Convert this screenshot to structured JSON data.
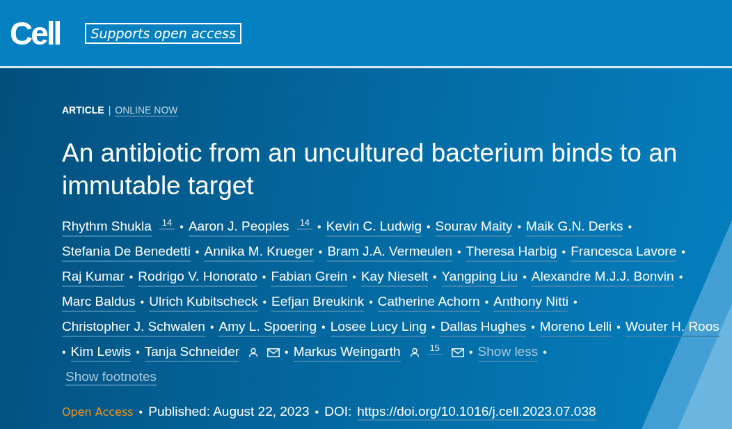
{
  "header": {
    "logo": "Cell",
    "badge": "Supports open access"
  },
  "article_type": "ARTICLE",
  "separator": "|",
  "status": "ONLINE NOW",
  "title": "An antibiotic from an uncultured bacterium binds to an immutable target",
  "author_separator": "•",
  "authors": [
    {
      "name": "Rhythm Shukla",
      "marks": [
        {
          "kind": "footnote",
          "text": "14"
        }
      ]
    },
    {
      "name": "Aaron J. Peoples",
      "marks": [
        {
          "kind": "footnote",
          "text": "14"
        }
      ]
    },
    {
      "name": "Kevin C. Ludwig"
    },
    {
      "name": "Sourav Maity"
    },
    {
      "name": "Maik G.N. Derks"
    },
    {
      "name": "Stefania De Benedetti"
    },
    {
      "name": "Annika M. Krueger"
    },
    {
      "name": "Bram J.A. Vermeulen"
    },
    {
      "name": "Theresa Harbig"
    },
    {
      "name": "Francesca Lavore"
    },
    {
      "name": "Raj Kumar"
    },
    {
      "name": "Rodrigo V. Honorato"
    },
    {
      "name": "Fabian Grein"
    },
    {
      "name": "Kay Nieselt"
    },
    {
      "name": "Yangping Liu"
    },
    {
      "name": "Alexandre M.J.J. Bonvin"
    },
    {
      "name": "Marc Baldus"
    },
    {
      "name": "Ulrich Kubitscheck"
    },
    {
      "name": "Eefjan Breukink"
    },
    {
      "name": "Catherine Achorn"
    },
    {
      "name": "Anthony Nitti"
    },
    {
      "name": "Christopher J. Schwalen"
    },
    {
      "name": "Amy L. Spoering"
    },
    {
      "name": "Losee Lucy Ling"
    },
    {
      "name": "Dallas Hughes"
    },
    {
      "name": "Moreno Lelli"
    },
    {
      "name": "Wouter H. Roos"
    },
    {
      "name": "Kim Lewis"
    },
    {
      "name": "Tanja Schneider",
      "marks": [
        {
          "kind": "person"
        },
        {
          "kind": "mail"
        }
      ]
    },
    {
      "name": "Markus Weingarth",
      "marks": [
        {
          "kind": "person"
        },
        {
          "kind": "footnote",
          "text": "15"
        },
        {
          "kind": "mail"
        }
      ]
    }
  ],
  "show_less": "Show less",
  "show_footnotes": "Show footnotes",
  "meta": {
    "access": "Open Access",
    "separator": "•",
    "published": "Published: August 22, 2023",
    "doi_label": "DOI:",
    "doi": "https://doi.org/10.1016/j.cell.2023.07.038"
  }
}
